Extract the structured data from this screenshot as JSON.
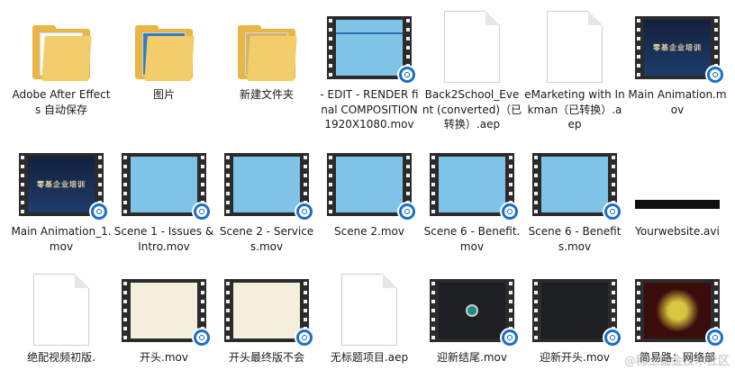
{
  "items": [
    {
      "label": "Adobe After Effects 自动保存",
      "type": "folder",
      "icon": "folder-icon"
    },
    {
      "label": "图片",
      "type": "folder",
      "icon": "folder-icon"
    },
    {
      "label": "新建文件夹",
      "type": "folder",
      "icon": "folder-icon"
    },
    {
      "label": "- EDIT - RENDER final COMPOSITION 1920X1080.mov",
      "type": "video",
      "icon": "video-file-icon"
    },
    {
      "label": "Back2School_Event (converted)（已转换）.aep",
      "type": "doc",
      "icon": "document-icon"
    },
    {
      "label": "eMarketing with Inkman（已转换）.aep",
      "type": "doc",
      "icon": "document-icon"
    },
    {
      "label": "Main Animation.mov",
      "type": "video",
      "icon": "video-file-icon"
    },
    {
      "label": "Main Animation_1.mov",
      "type": "video",
      "icon": "video-file-icon"
    },
    {
      "label": "Scene 1 - Issues & Intro.mov",
      "type": "video",
      "icon": "video-file-icon"
    },
    {
      "label": "Scene 2 - Services.mov",
      "type": "video",
      "icon": "video-file-icon"
    },
    {
      "label": "Scene 2.mov",
      "type": "video",
      "icon": "video-file-icon"
    },
    {
      "label": "Scene 6 - Benefit.mov",
      "type": "video",
      "icon": "video-file-icon"
    },
    {
      "label": "Scene 6 - Benefits.mov",
      "type": "video",
      "icon": "video-file-icon"
    },
    {
      "label": "Yourwebsite.avi",
      "type": "avi",
      "icon": "avi-file-icon"
    },
    {
      "label": "绝配视频初版.",
      "type": "doc",
      "icon": "document-icon"
    },
    {
      "label": "开头.mov",
      "type": "video",
      "icon": "video-file-icon"
    },
    {
      "label": "开头最终版不会",
      "type": "video",
      "icon": "video-file-icon"
    },
    {
      "label": "无标题项目.aep",
      "type": "doc",
      "icon": "document-icon"
    },
    {
      "label": "迎新结尾.mov",
      "type": "video",
      "icon": "video-file-icon"
    },
    {
      "label": "迎新开头.mov",
      "type": "video",
      "icon": "video-file-icon"
    },
    {
      "label": "简易路：网络部",
      "type": "video",
      "icon": "video-file-icon"
    }
  ],
  "frame_texts": {
    "main_title": "零基企业培训"
  },
  "watermark": "@稀土掘金技术社区"
}
